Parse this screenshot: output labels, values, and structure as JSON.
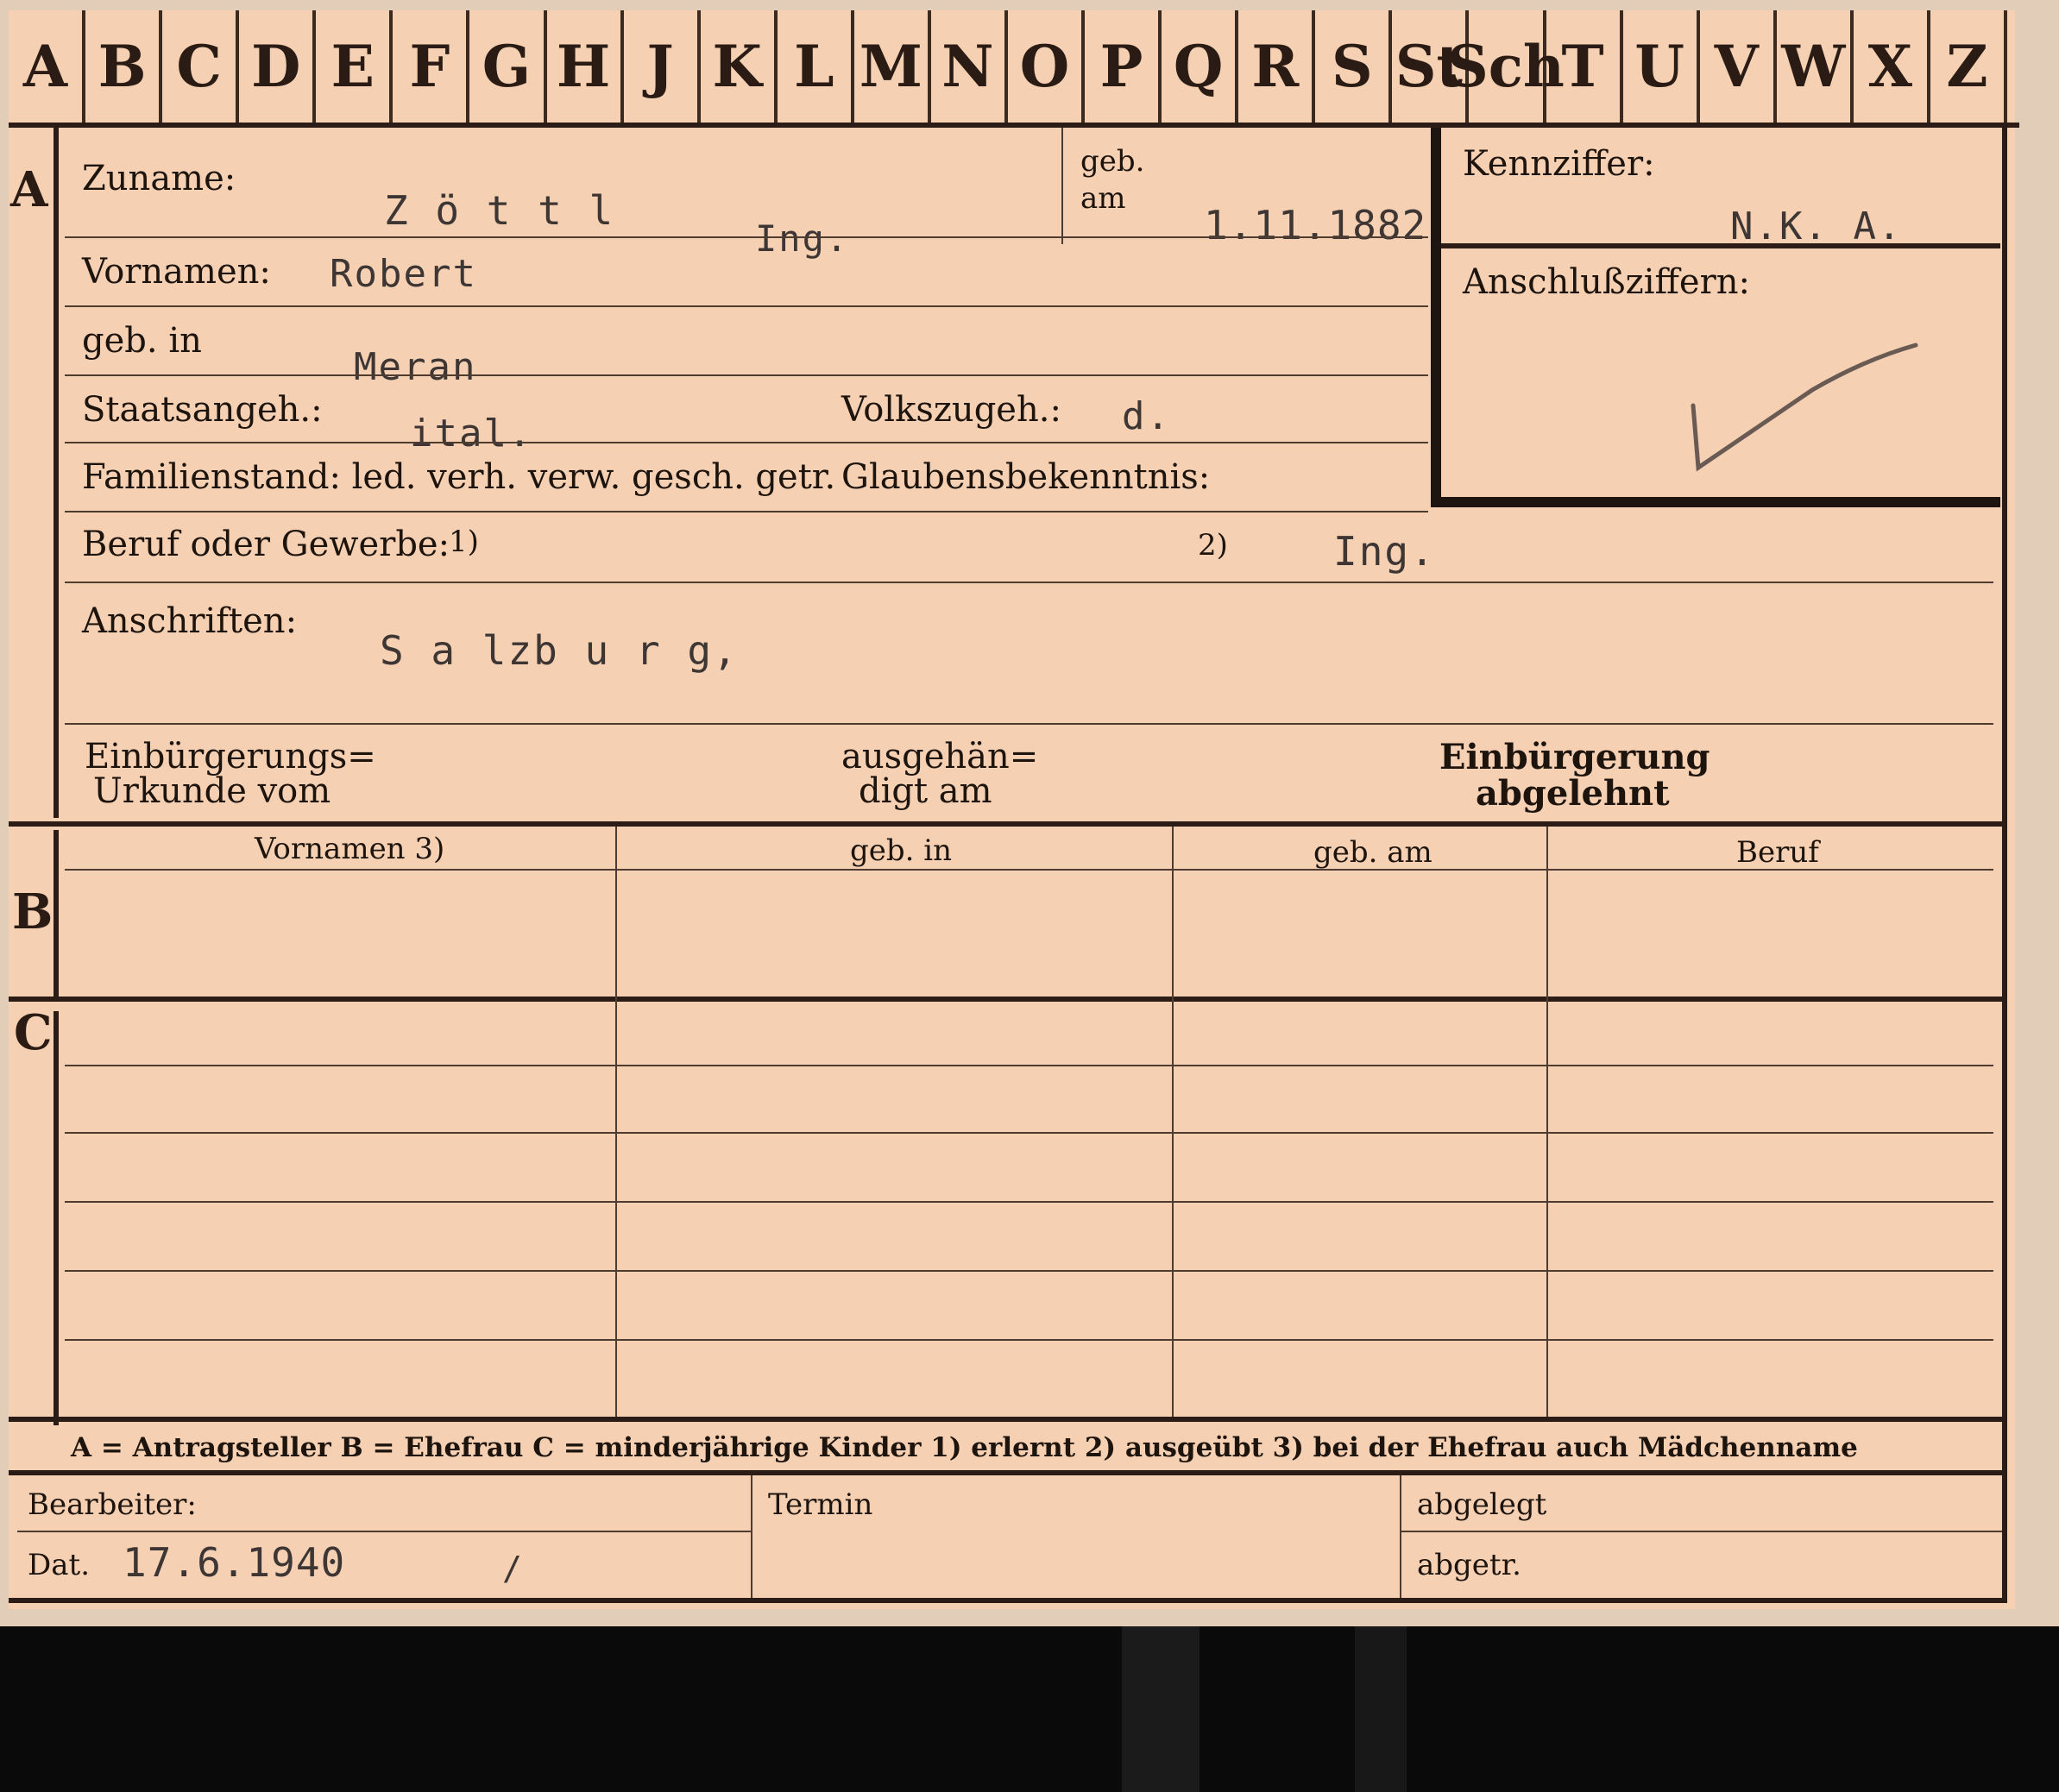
{
  "alphabet": [
    "A",
    "B",
    "C",
    "D",
    "E",
    "F",
    "G",
    "H",
    "J",
    "K",
    "L",
    "M",
    "N",
    "O",
    "P",
    "Q",
    "R",
    "S",
    "St",
    "Sch",
    "T",
    "U",
    "V",
    "W",
    "X",
    "Z"
  ],
  "sections": {
    "a": "A",
    "b": "B",
    "c": "C"
  },
  "labels": {
    "zuname": "Zuname:",
    "geb_am": "geb.\nam",
    "geb_label": "geb.",
    "am_label": "am",
    "vornamen": "Vornamen:",
    "geb_in": "geb. in",
    "staatsangeh": "Staatsangeh.:",
    "volkszugeh": "Volkszugeh.:",
    "familienstand": "Familienstand: led. verh. verw. gesch. getr.",
    "glaubensbekenntnis": "Glaubensbekenntnis:",
    "beruf": "Beruf oder Gewerbe:",
    "beruf_note1": "1)",
    "beruf_note2": "2)",
    "anschriften": "Anschriften:",
    "einbuergerungs_line1": "Einbürgerungs=",
    "einbuergerungs_line2": "Urkunde vom",
    "ausgehaen_line1": "ausgehän=",
    "ausgehaen_line2": "digt am",
    "einbuergerung_line1": "Einbürgerung",
    "einbuergerung_line2": "abgelehnt",
    "kennziffer": "Kennziffer:",
    "anschlussziffern": "Anschlußziffern:",
    "legend": "A = Antragsteller   B = Ehefrau   C = minderjährige Kinder   1) erlernt   2) ausgeübt   3) bei der Ehefrau auch Mädchenname",
    "bearbeiter": "Bearbeiter:",
    "dat": "Dat.",
    "termin": "Termin",
    "abgelegt": "abgelegt",
    "abgetr": "abgetr."
  },
  "table_headers": [
    "Vornamen 3)",
    "geb. in",
    "geb. am",
    "Beruf"
  ],
  "values": {
    "zuname": "Z ö t t l",
    "zuname_title": "Ing.",
    "geb_am": "1.11.1882",
    "vornamen": "Robert",
    "geb_in": "Meran",
    "staatsangeh": "ital.",
    "volkszugeh": "d.",
    "beruf_2": "Ing.",
    "anschrift": "S a lzb u r g,",
    "kennziffer": "N.K.    A.",
    "dat": "17.6.1940",
    "dat_mark": "/"
  }
}
